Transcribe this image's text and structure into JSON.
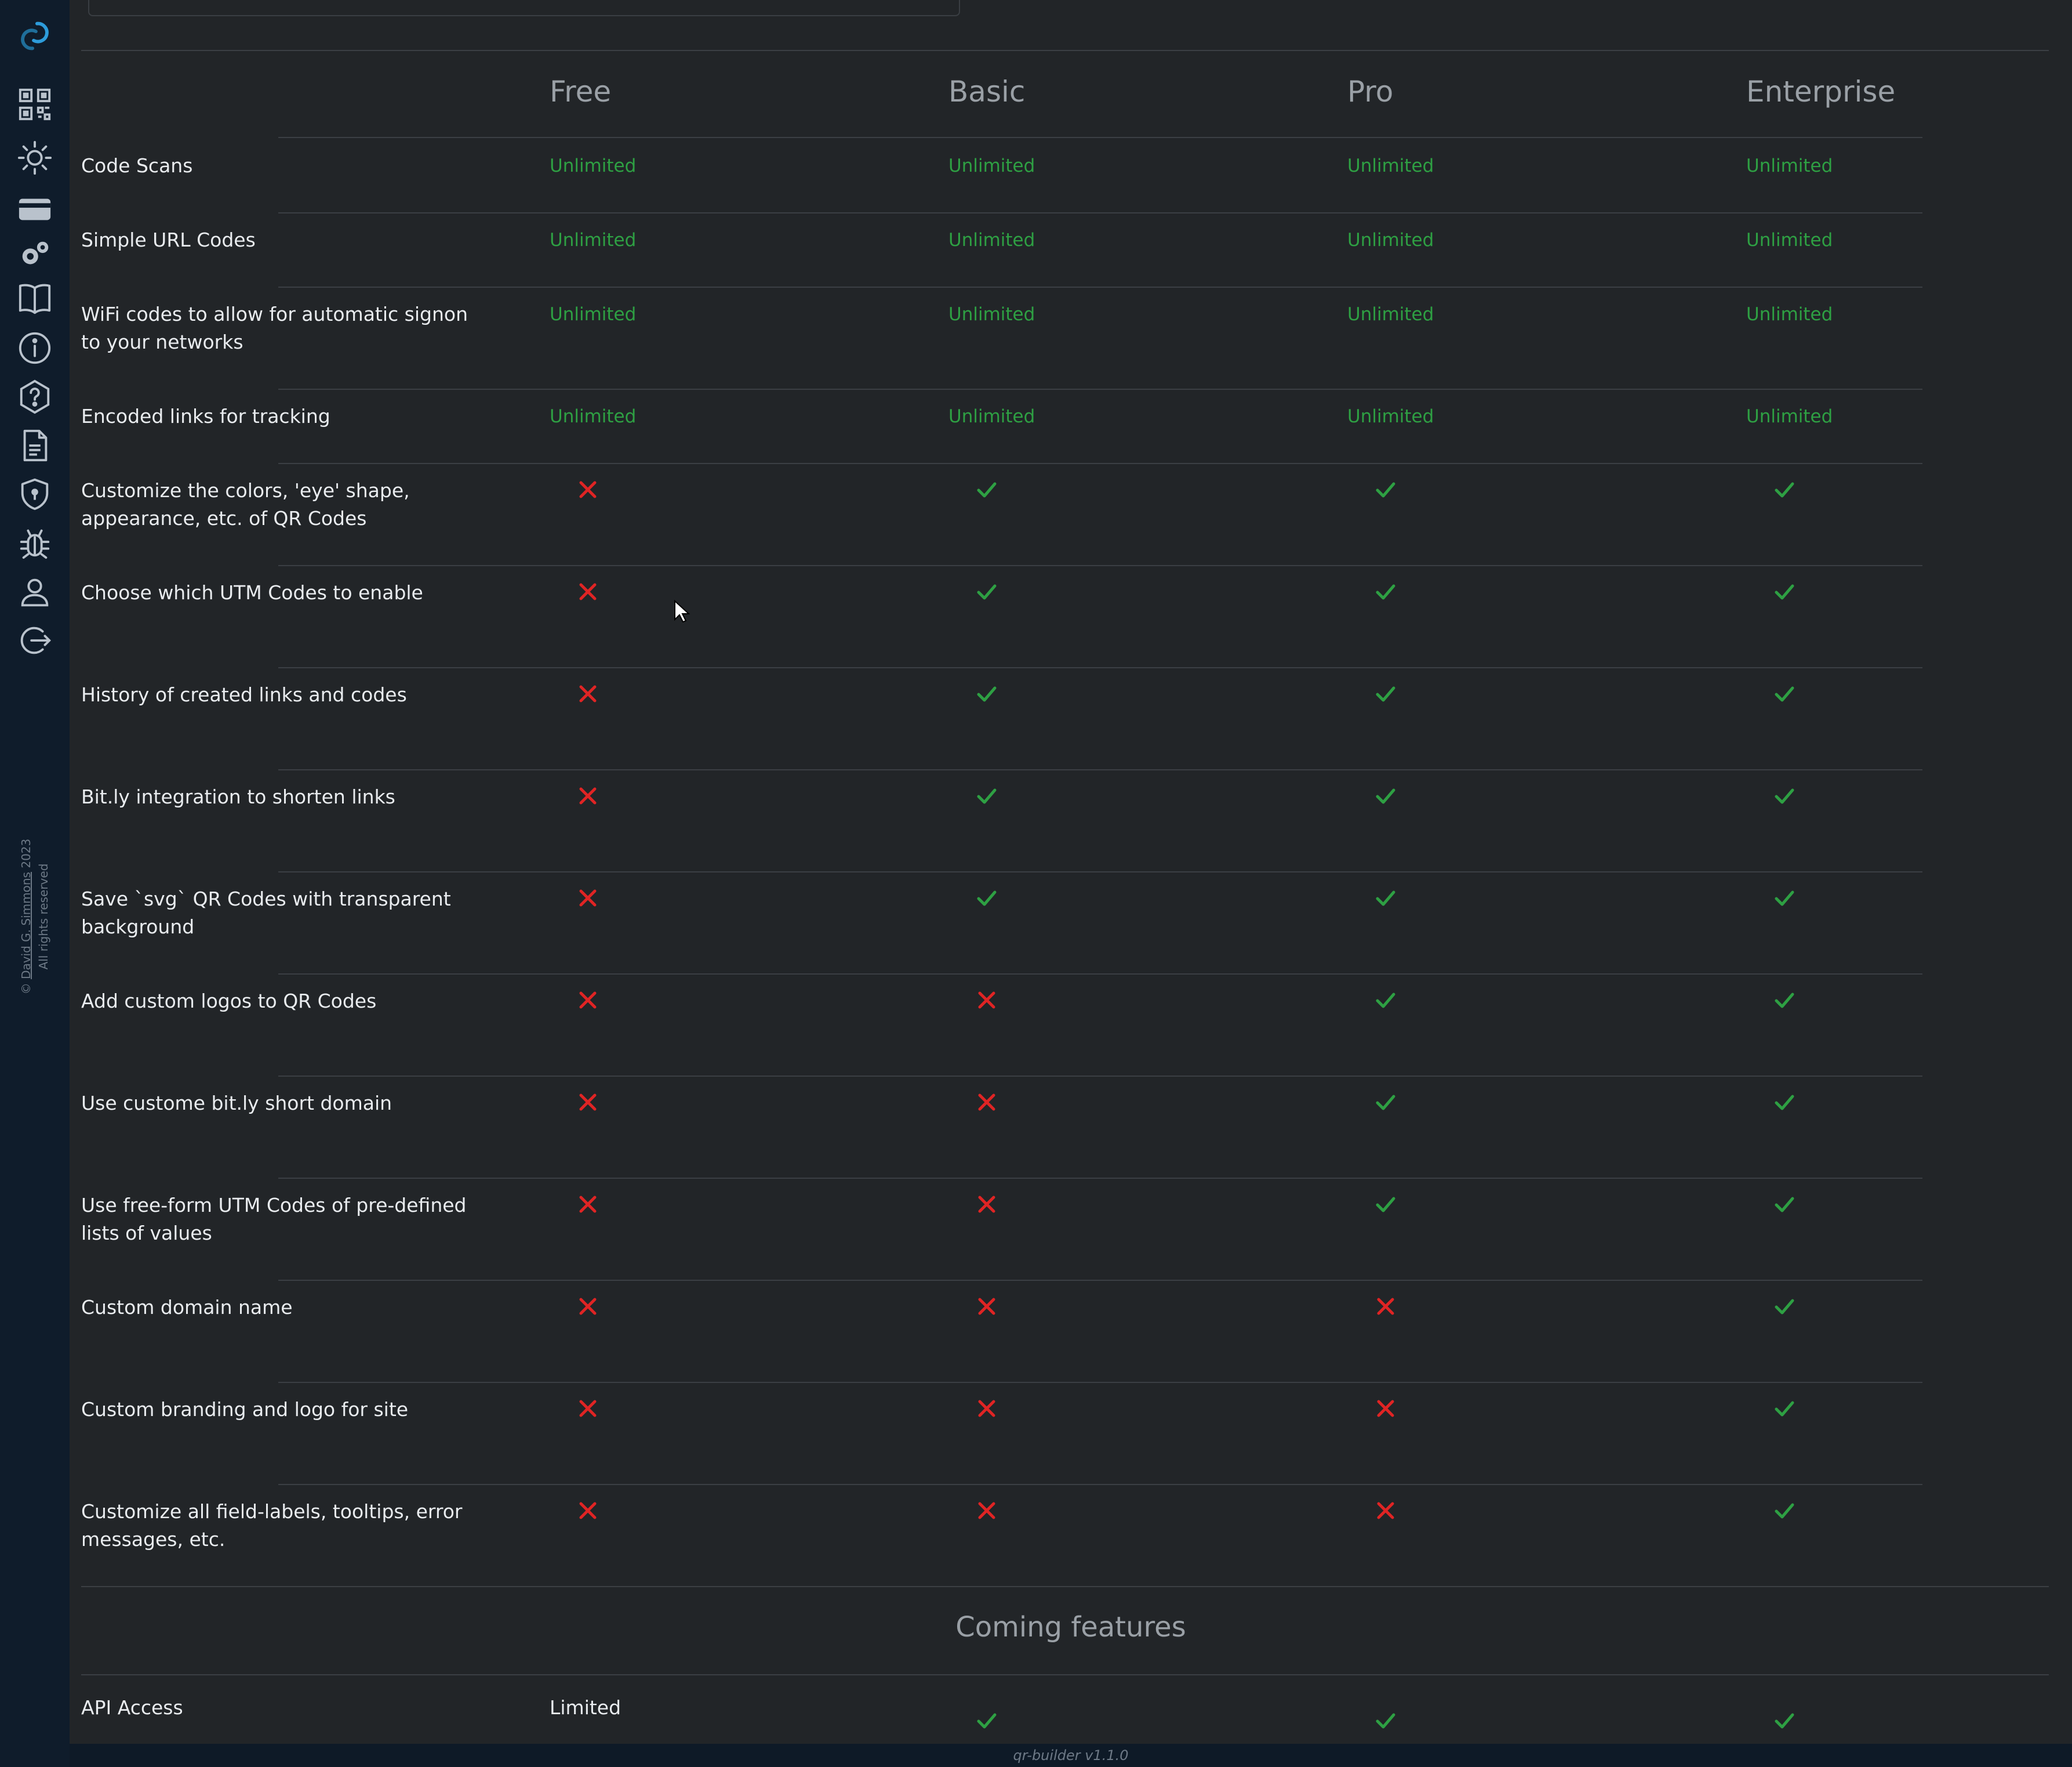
{
  "app": {
    "version": "qr-builder v1.1.0",
    "copyright_name": "David G. Simmons",
    "copyright_year": "2023",
    "copyright_rights": "All rights reserved",
    "accent_color": "#2ea043",
    "deny_color": "#e02424"
  },
  "sidebar": {
    "icons": [
      "logo-icon",
      "qr-code-icon",
      "sun-icon",
      "credit-card-icon",
      "gears-icon",
      "book-icon",
      "info-icon",
      "help-icon",
      "document-icon",
      "shield-icon",
      "bug-icon",
      "user-icon",
      "logout-icon"
    ]
  },
  "pricing": {
    "tiers": [
      "Free",
      "Basic",
      "Pro",
      "Enterprise"
    ],
    "features": [
      {
        "label": "Code Scans",
        "values": [
          "Unlimited",
          "Unlimited",
          "Unlimited",
          "Unlimited"
        ]
      },
      {
        "label": "Simple URL Codes",
        "values": [
          "Unlimited",
          "Unlimited",
          "Unlimited",
          "Unlimited"
        ]
      },
      {
        "label": "WiFi codes to allow for automatic signon to your networks",
        "values": [
          "Unlimited",
          "Unlimited",
          "Unlimited",
          "Unlimited"
        ]
      },
      {
        "label": "Encoded links for tracking",
        "values": [
          "Unlimited",
          "Unlimited",
          "Unlimited",
          "Unlimited"
        ]
      },
      {
        "label": "Customize the colors, 'eye' shape, appearance, etc. of QR Codes",
        "values": [
          false,
          true,
          true,
          true
        ]
      },
      {
        "label": "Choose which UTM Codes to enable",
        "values": [
          false,
          true,
          true,
          true
        ]
      },
      {
        "label": "History of created links and codes",
        "values": [
          false,
          true,
          true,
          true
        ]
      },
      {
        "label": "Bit.ly integration to shorten links",
        "values": [
          false,
          true,
          true,
          true
        ]
      },
      {
        "label": "Save `svg` QR Codes with transparent background",
        "values": [
          false,
          true,
          true,
          true
        ]
      },
      {
        "label": "Add custom logos to QR Codes",
        "values": [
          false,
          false,
          true,
          true
        ]
      },
      {
        "label": "Use custome bit.ly short domain",
        "values": [
          false,
          false,
          true,
          true
        ]
      },
      {
        "label": "Use free-form UTM Codes of pre-defined lists of values",
        "values": [
          false,
          false,
          true,
          true
        ]
      },
      {
        "label": "Custom domain name",
        "values": [
          false,
          false,
          false,
          true
        ]
      },
      {
        "label": "Custom branding and logo for site",
        "values": [
          false,
          false,
          false,
          true
        ]
      },
      {
        "label": "Customize all field-labels, tooltips, error messages, etc.",
        "values": [
          false,
          false,
          false,
          true
        ]
      }
    ],
    "coming_title": "Coming features",
    "coming": [
      {
        "label": "API Access",
        "values": [
          "Limited",
          true,
          true,
          true
        ]
      }
    ]
  }
}
